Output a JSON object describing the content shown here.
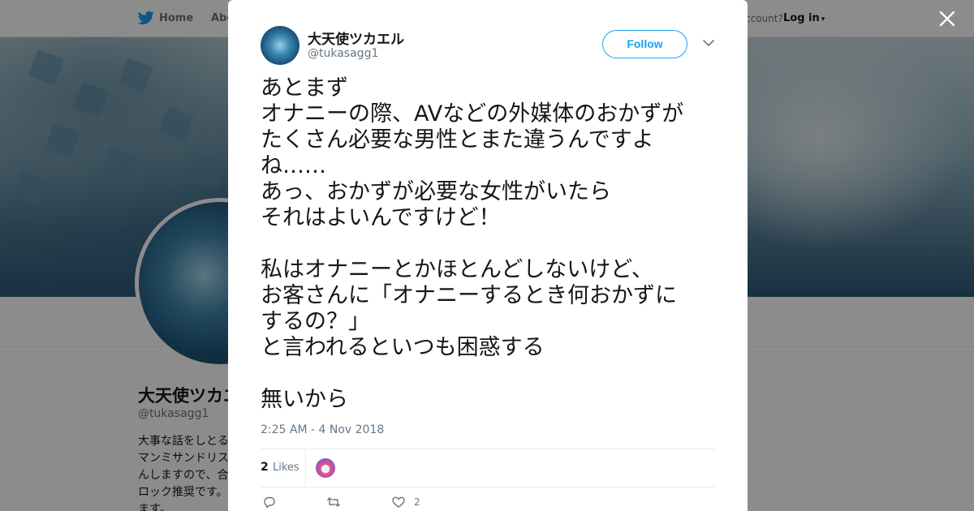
{
  "nav": {
    "home_label": "Home",
    "about_label": "Abo",
    "account_text": "ccount?",
    "login_label": "Log in",
    "login_caret": "▾"
  },
  "profile": {
    "name": "大天使ツカエル",
    "handle": "@tukasagg1",
    "bio_lines": [
      "大事な話をしとる",
      "マンミサンドリス",
      "んしますので、合",
      "ロック推奨です。",
      "ます。"
    ]
  },
  "tweet": {
    "author_name": "大天使ツカエル",
    "author_handle": "@tukasagg1",
    "follow_label": "Follow",
    "text": "あとまず\nオナニーの際、AVなどの外媒体のおかずが\nたくさん必要な男性とまた違うんですよ\nね……\nあっ、おかずが必要な女性がいたら\nそれはよいんですけど！\n\n私はオナニーとかほとんどしないけど、\nお客さんに「オナニーするとき何おかずに\nするの？」\nと言われるといつも困惑する\n\n無いから",
    "timestamp": "2:25 AM - 4 Nov 2018",
    "likes_count": "2",
    "likes_label": "Likes",
    "action_like_count": "2"
  },
  "icons": {
    "close": "close-icon",
    "bird": "twitter-bird-icon",
    "chevron": "chevron-down-icon",
    "reply": "reply-icon",
    "retweet": "retweet-icon",
    "like": "heart-icon"
  },
  "colors": {
    "brand": "#1da1f2",
    "text": "#14171a",
    "muted": "#657786"
  }
}
